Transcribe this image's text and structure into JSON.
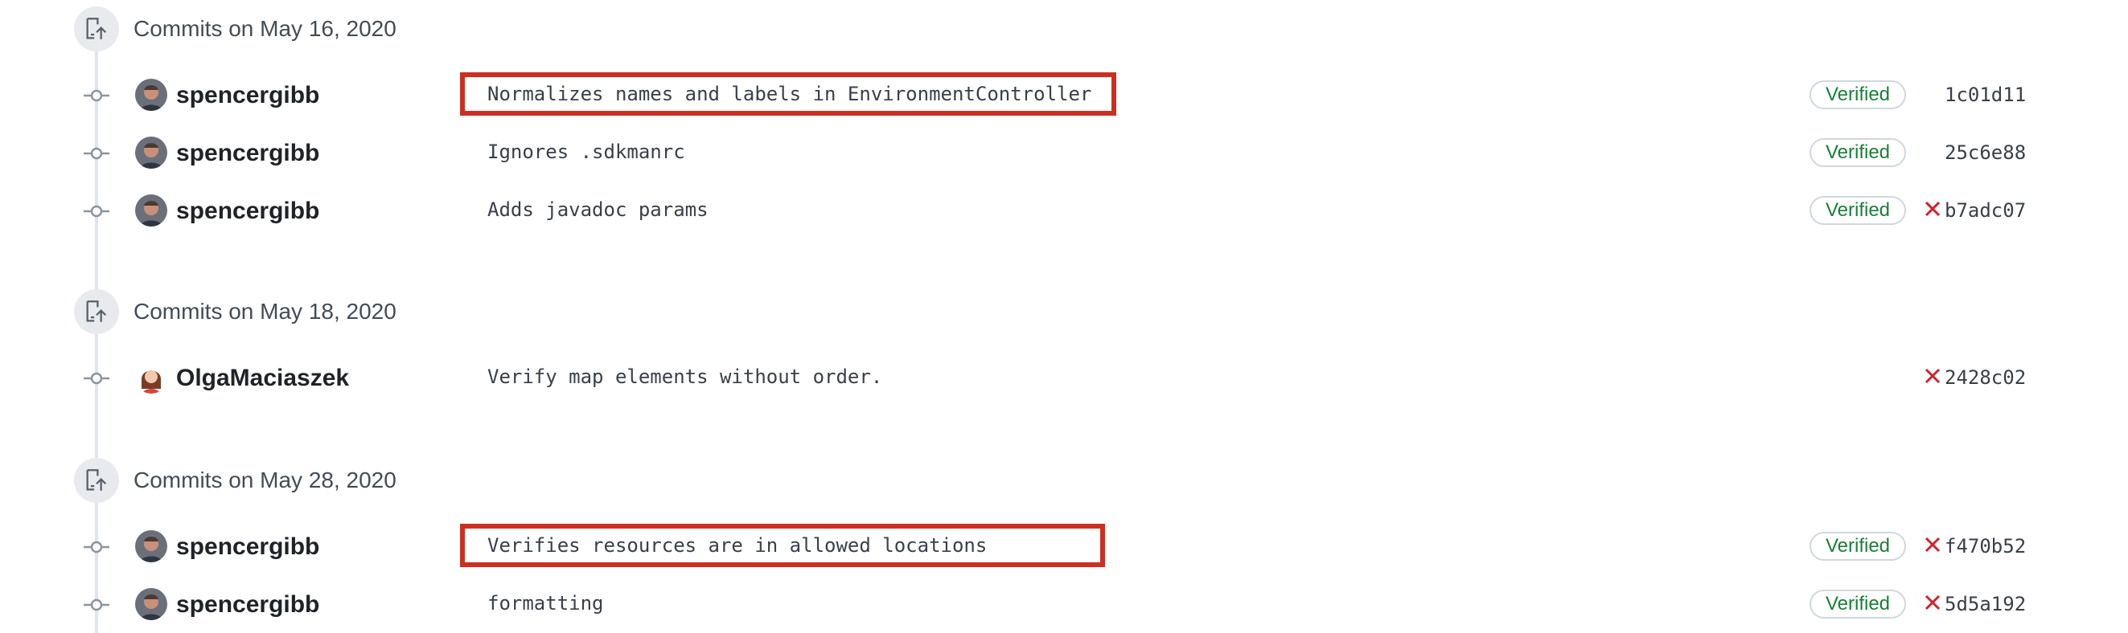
{
  "groups": [
    {
      "title": "Commits on May 16, 2020"
    },
    {
      "title": "Commits on May 18, 2020"
    },
    {
      "title": "Commits on May 28, 2020"
    }
  ],
  "commits": [
    {
      "author": "spencergibb",
      "message": "Normalizes names and labels in EnvironmentController",
      "verified": "Verified",
      "failed": false,
      "sha": "1c01d11"
    },
    {
      "author": "spencergibb",
      "message": "Ignores .sdkmanrc",
      "verified": "Verified",
      "failed": false,
      "sha": "25c6e88"
    },
    {
      "author": "spencergibb",
      "message": "Adds javadoc params",
      "verified": "Verified",
      "failed": true,
      "sha": "b7adc07"
    },
    {
      "author": "OlgaMaciaszek",
      "message": "Verify map elements without order.",
      "verified": "",
      "failed": true,
      "sha": "2428c02"
    },
    {
      "author": "spencergibb",
      "message": "Verifies resources are in allowed locations",
      "verified": "Verified",
      "failed": true,
      "sha": "f470b52"
    },
    {
      "author": "spencergibb",
      "message": "formatting",
      "verified": "Verified",
      "failed": true,
      "sha": "5d5a192"
    }
  ],
  "colors": {
    "highlight": "#cc2f22",
    "verified": "#1a7f37",
    "failed": "#cf222e",
    "timeline": "#e1e4e8"
  },
  "icons": {
    "group": "commit-push-icon",
    "node": "git-commit-icon",
    "failed": "x-icon"
  }
}
